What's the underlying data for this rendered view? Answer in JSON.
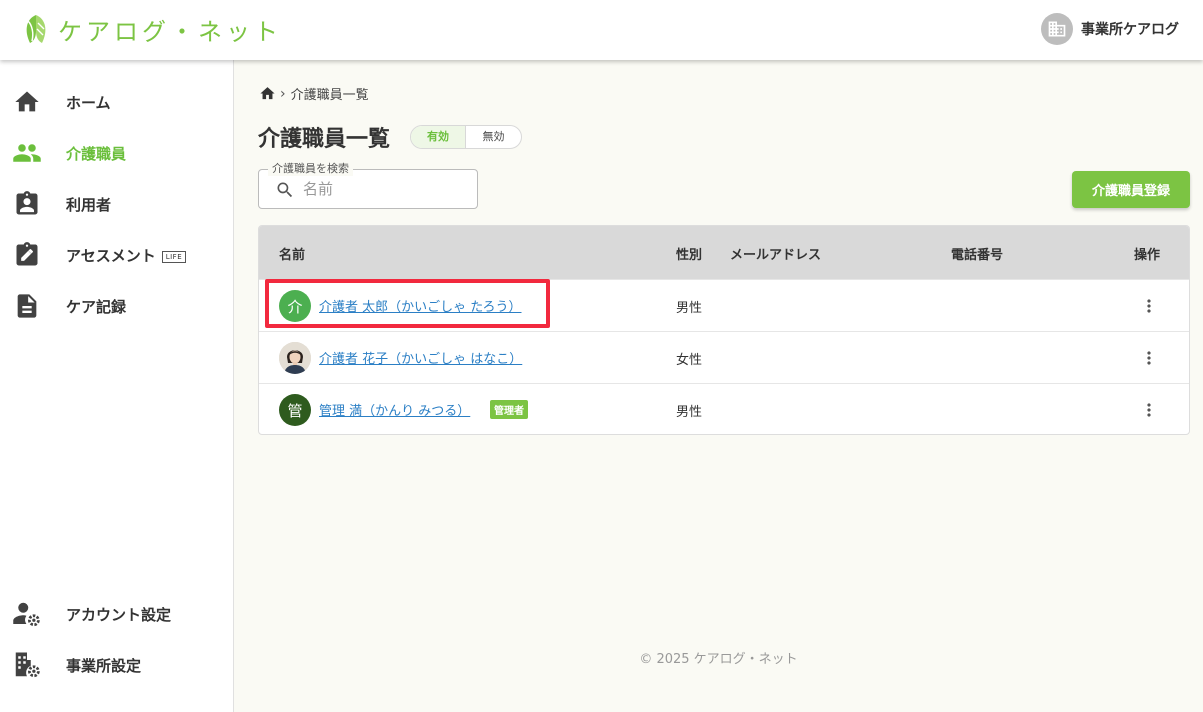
{
  "app": {
    "name": "ケアログ・ネット",
    "office_name": "事業所ケアログ"
  },
  "sidebar": {
    "items": [
      {
        "label": "ホーム",
        "icon": "home-icon"
      },
      {
        "label": "介護職員",
        "icon": "people-icon",
        "active": true
      },
      {
        "label": "利用者",
        "icon": "user-badge-icon"
      },
      {
        "label": "アセスメント",
        "badge": "LIFE",
        "icon": "clipboard-edit-icon"
      },
      {
        "label": "ケア記録",
        "icon": "document-icon"
      }
    ],
    "bottom_items": [
      {
        "label": "アカウント設定",
        "icon": "user-settings-icon"
      },
      {
        "label": "事業所設定",
        "icon": "building-settings-icon"
      }
    ]
  },
  "breadcrumb": {
    "home_icon": "home-icon",
    "current": "介護職員一覧"
  },
  "page": {
    "title": "介護職員一覧",
    "toggle": {
      "active": "有効",
      "inactive": "無効"
    },
    "search": {
      "label": "介護職員を検索",
      "placeholder": "名前"
    },
    "register_button": "介護職員登録"
  },
  "table": {
    "headers": {
      "name": "名前",
      "gender": "性別",
      "email": "メールアドレス",
      "phone": "電話番号",
      "actions": "操作"
    },
    "rows": [
      {
        "avatar": "介",
        "avatar_color": "#4caf50",
        "name": "介護者 太郎（かいごしゃ たろう）",
        "gender": "男性"
      },
      {
        "avatar": "",
        "photo": true,
        "name": "介護者 花子（かいごしゃ はなこ）",
        "gender": "女性"
      },
      {
        "avatar": "管",
        "avatar_color": "#2e5b1e",
        "name": "管理 満（かんり みつる）",
        "gender": "男性",
        "badge": "管理者"
      }
    ]
  },
  "footer": "© 2025 ケアログ・ネット",
  "colors": {
    "brand": "#7cc443",
    "link": "#2b7fc5",
    "highlight": "#f2293e"
  }
}
